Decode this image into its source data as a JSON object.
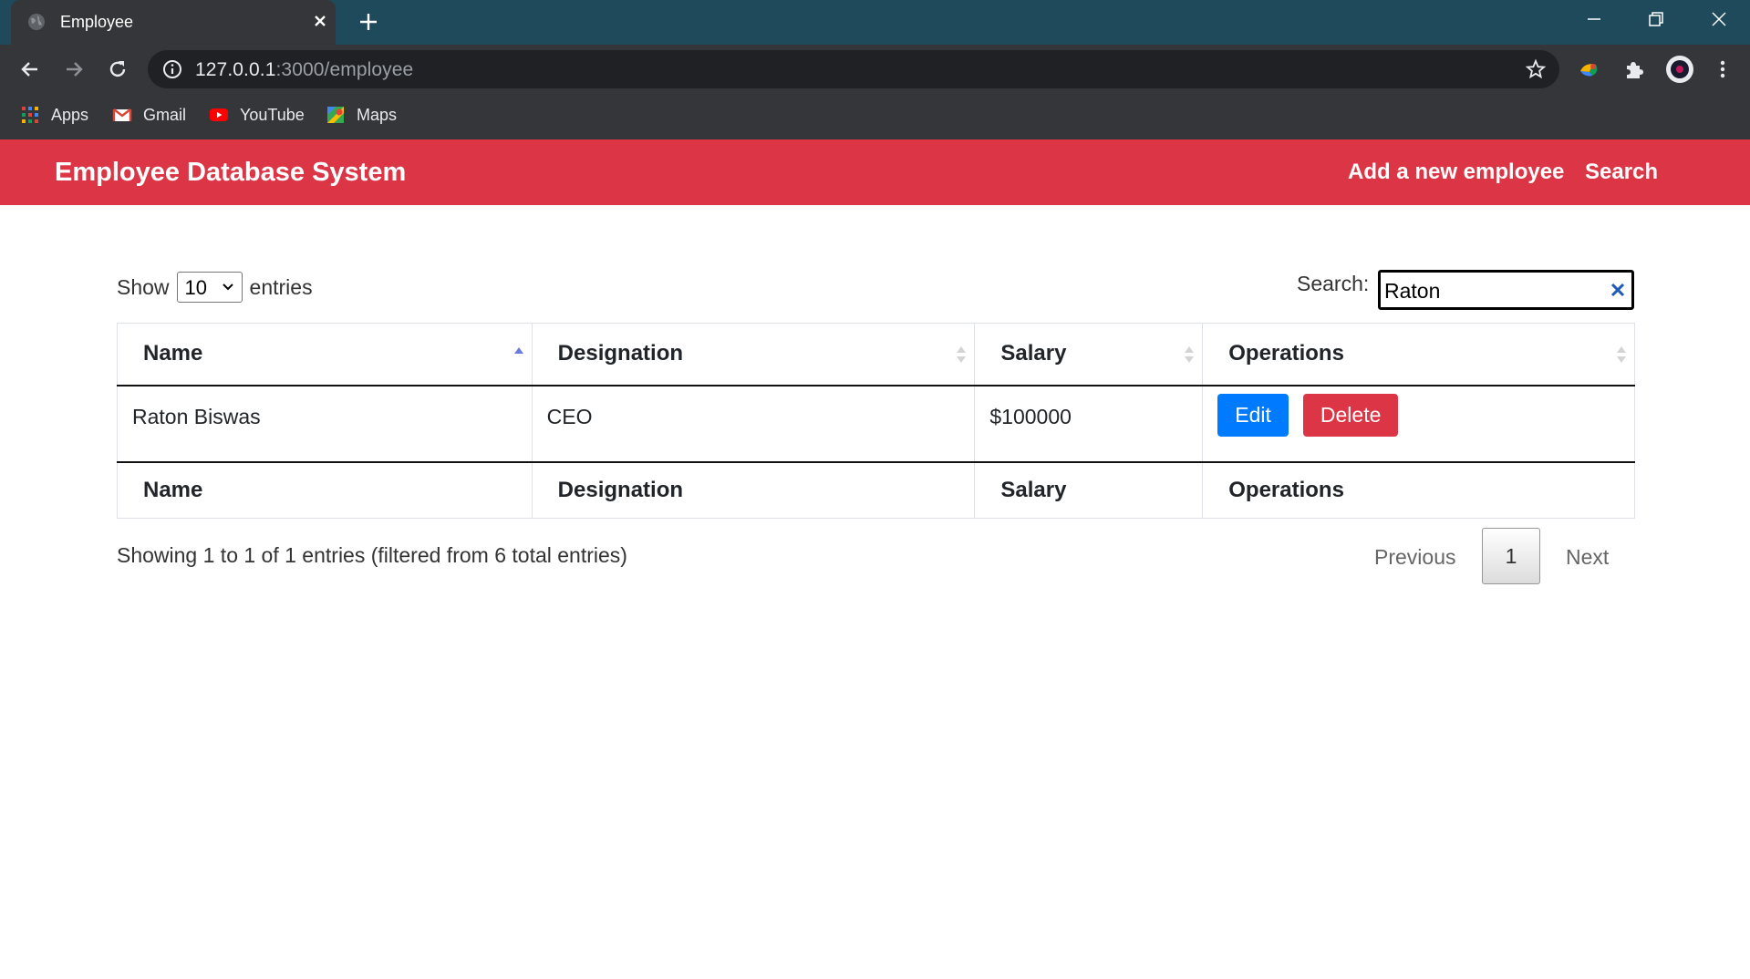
{
  "browser": {
    "tab_title": "Employee",
    "url_host": "127.0.0.1",
    "url_path": ":3000/employee",
    "bookmarks": [
      {
        "label": "Apps",
        "icon": "apps-grid-icon"
      },
      {
        "label": "Gmail",
        "icon": "gmail-icon"
      },
      {
        "label": "YouTube",
        "icon": "youtube-icon"
      },
      {
        "label": "Maps",
        "icon": "maps-icon"
      }
    ]
  },
  "navbar": {
    "brand": "Employee Database System",
    "links": [
      "Add a new employee",
      "Search"
    ],
    "color": "#dc3545"
  },
  "table_controls": {
    "show_label": "Show",
    "page_length": "10",
    "entries_label": "entries",
    "search_label": "Search:",
    "search_value": "Raton"
  },
  "table": {
    "columns": [
      "Name",
      "Designation",
      "Salary",
      "Operations"
    ],
    "sorted_column": "Name",
    "rows": [
      {
        "name": "Raton Biswas",
        "designation": "CEO",
        "salary": "$100000",
        "edit_label": "Edit",
        "delete_label": "Delete"
      }
    ],
    "footer_columns": [
      "Name",
      "Designation",
      "Salary",
      "Operations"
    ]
  },
  "info": "Showing 1 to 1 of 1 entries (filtered from 6 total entries)",
  "pagination": {
    "previous": "Previous",
    "current": "1",
    "next": "Next"
  },
  "colors": {
    "edit_button": "#007bff",
    "delete_button": "#dc3545",
    "titlebar": "#1f4a5c",
    "toolbar": "#353639"
  }
}
